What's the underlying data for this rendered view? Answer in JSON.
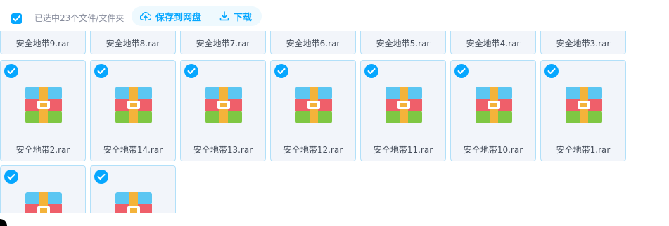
{
  "toolbar": {
    "selected_text": "已选中23个文件/文件夹",
    "save_label": "保存到网盘",
    "download_label": "下载"
  },
  "colors": {
    "accent": "#06a7ff",
    "tile_bg": "#f2f5fa",
    "tile_border": "#b2e0f9"
  },
  "files": {
    "row1": [
      "安全地带9.rar",
      "安全地带8.rar",
      "安全地带7.rar",
      "安全地带6.rar",
      "安全地带5.rar",
      "安全地带4.rar",
      "安全地带3.rar"
    ],
    "row2": [
      "安全地带2.rar",
      "安全地带14.rar",
      "安全地带13.rar",
      "安全地带12.rar",
      "安全地带11.rar",
      "安全地带10.rar",
      "安全地带1.rar"
    ]
  },
  "icons": {
    "select_all": "checkbox-checked-icon",
    "save": "cloud-upload-icon",
    "download": "download-icon",
    "file": "archive-rar-icon",
    "tile_check": "check-circle-icon"
  }
}
